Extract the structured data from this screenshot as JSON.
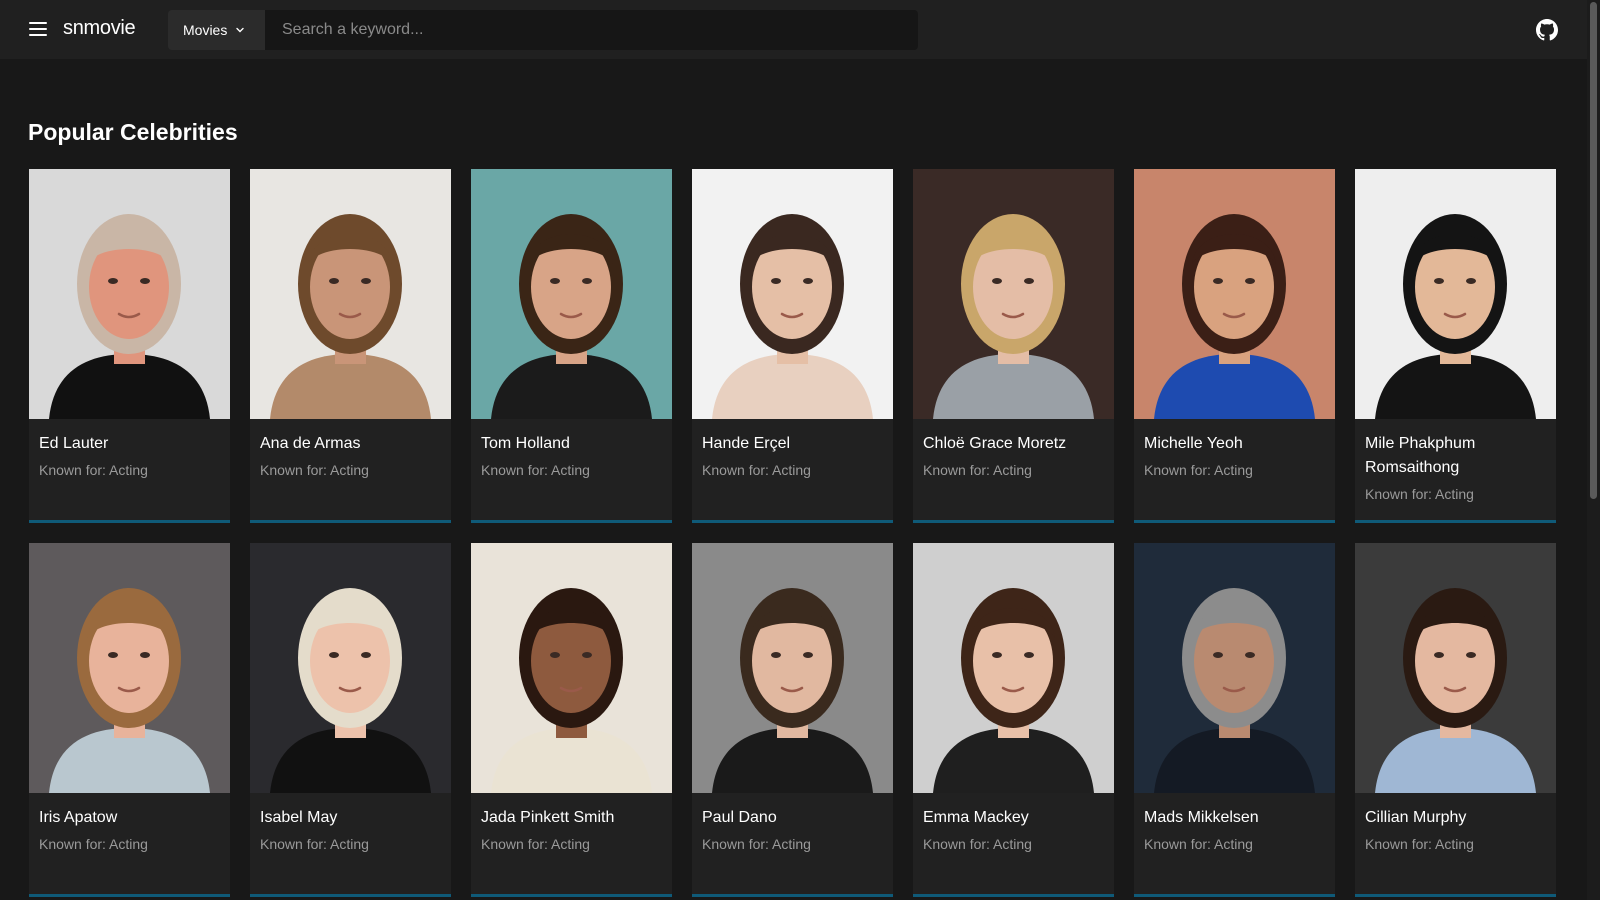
{
  "header": {
    "app_name": "snmovie",
    "category_label": "Movies",
    "search_placeholder": "Search a keyword..."
  },
  "section": {
    "title": "Popular Celebrities"
  },
  "known_prefix": "Known for:",
  "celebrities": [
    {
      "name": "Ed Lauter",
      "known_for": "Known for: Acting",
      "bg": "#d9d9d9",
      "skin": "#e0957d",
      "hair": "#c9b6a6",
      "shirt": "#111111"
    },
    {
      "name": "Ana de Armas",
      "known_for": "Known for: Acting",
      "bg": "#e8e6e2",
      "skin": "#c99578",
      "hair": "#6e4a2c",
      "shirt": "#b38a6a"
    },
    {
      "name": "Tom Holland",
      "known_for": "Known for: Acting",
      "bg": "#6aa7a6",
      "skin": "#d8a487",
      "hair": "#3a2516",
      "shirt": "#1b1b1b"
    },
    {
      "name": "Hande Erçel",
      "known_for": "Known for: Acting",
      "bg": "#f2f2f2",
      "skin": "#e5bfa6",
      "hair": "#3a2820",
      "shirt": "#e8d0c0"
    },
    {
      "name": "Chloë Grace Moretz",
      "known_for": "Known for: Acting",
      "bg": "#3a2a26",
      "skin": "#e4bda6",
      "hair": "#c9a66a",
      "shirt": "#9aa0a6"
    },
    {
      "name": "Michelle Yeoh",
      "known_for": "Known for: Acting",
      "bg": "#c8856b",
      "skin": "#d9a27f",
      "hair": "#3b1f16",
      "shirt": "#1e4bb0"
    },
    {
      "name": "Mile Phakphum Romsaithong",
      "known_for": "Known for: Acting",
      "bg": "#eeeeee",
      "skin": "#e3b898",
      "hair": "#141414",
      "shirt": "#141414"
    },
    {
      "name": "Iris Apatow",
      "known_for": "Known for: Acting",
      "bg": "#5e5a5c",
      "skin": "#e8b39b",
      "hair": "#9a6a3e",
      "shirt": "#b9c7cf"
    },
    {
      "name": "Isabel May",
      "known_for": "Known for: Acting",
      "bg": "#2a2a2e",
      "skin": "#edc2ab",
      "hair": "#e4dccb",
      "shirt": "#111111"
    },
    {
      "name": "Jada Pinkett Smith",
      "known_for": "Known for: Acting",
      "bg": "#e9e3d9",
      "skin": "#8e5a3e",
      "hair": "#2a1810",
      "shirt": "#eae3d3"
    },
    {
      "name": "Paul Dano",
      "known_for": "Known for: Acting",
      "bg": "#8a8a8a",
      "skin": "#e1b8a0",
      "hair": "#3a2a1e",
      "shirt": "#1a1a1a"
    },
    {
      "name": "Emma Mackey",
      "known_for": "Known for: Acting",
      "bg": "#cfcfcf",
      "skin": "#e8c0a8",
      "hair": "#3e2518",
      "shirt": "#1f1f1f"
    },
    {
      "name": "Mads Mikkelsen",
      "known_for": "Known for: Acting",
      "bg": "#1f2b3a",
      "skin": "#b98a70",
      "hair": "#8c8c8c",
      "shirt": "#141a24"
    },
    {
      "name": "Cillian Murphy",
      "known_for": "Known for: Acting",
      "bg": "#3b3b3b",
      "skin": "#e4b8a0",
      "hair": "#2a1a12",
      "shirt": "#9fb7d4"
    }
  ]
}
